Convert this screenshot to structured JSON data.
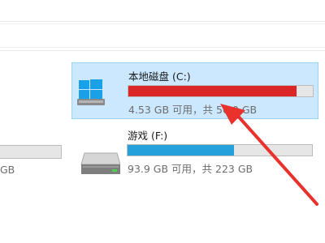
{
  "drives": [
    {
      "name": "本地磁盘 (C:)",
      "info": "4.53 GB 可用，共 50.0 GB",
      "used_fraction": 0.91,
      "selected": true,
      "icon": "windows-drive-icon",
      "bar_color": "#da2626"
    },
    {
      "name": "游戏 (F:)",
      "info": "93.9 GB 可用，共 223 GB",
      "used_fraction": 0.579,
      "selected": false,
      "icon": "hard-drive-icon",
      "bar_color": "#26a0da"
    }
  ],
  "partial_left": {
    "info_fragment": "GB"
  },
  "annotation": {
    "arrow_color": "#e8322b"
  }
}
